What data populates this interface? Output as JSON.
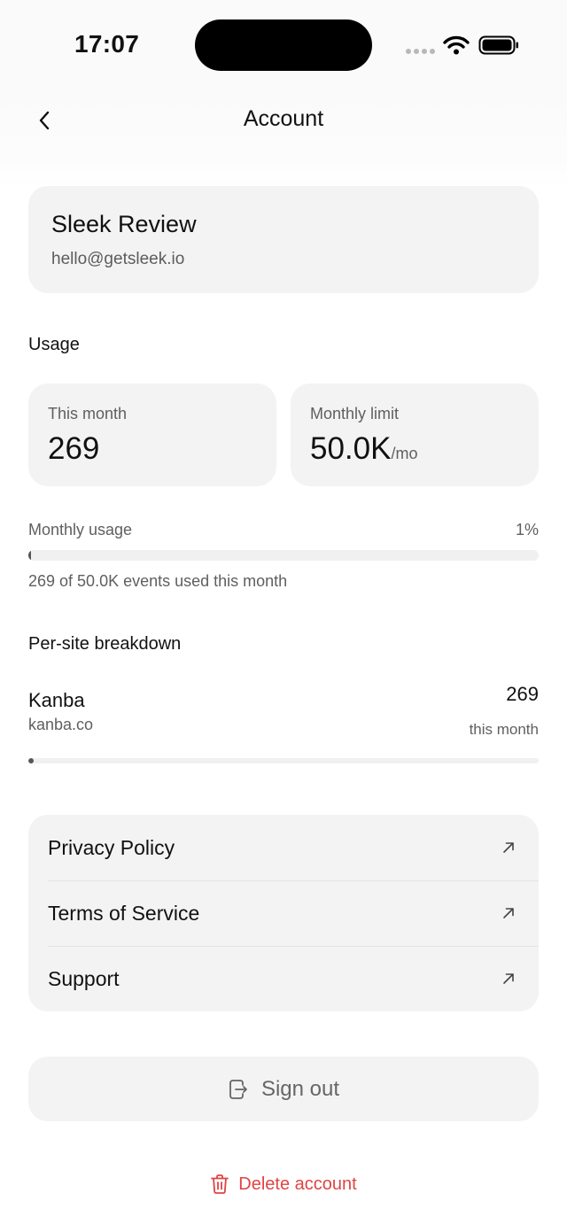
{
  "status": {
    "time": "17:07"
  },
  "nav": {
    "title": "Account"
  },
  "profile": {
    "name": "Sleek Review",
    "email": "hello@getsleek.io"
  },
  "usage": {
    "section_label": "Usage",
    "this_month_label": "This month",
    "this_month_value": "269",
    "limit_label": "Monthly limit",
    "limit_value": "50.0K",
    "limit_unit": "/mo",
    "progress_label": "Monthly usage",
    "progress_percent": "1%",
    "progress_fraction": 0.0054,
    "note": "269 of 50.0K events used this month"
  },
  "breakdown": {
    "section_label": "Per-site breakdown",
    "sites": [
      {
        "name": "Kanba",
        "domain": "kanba.co",
        "count": "269",
        "period": "this month",
        "fraction": 0.01
      }
    ]
  },
  "links": [
    {
      "label": "Privacy Policy",
      "icon": "arrow-up-right-icon"
    },
    {
      "label": "Terms of Service",
      "icon": "arrow-up-right-icon"
    },
    {
      "label": "Support",
      "icon": "arrow-up-right-icon"
    }
  ],
  "actions": {
    "sign_out": "Sign out",
    "delete_account": "Delete account"
  },
  "colors": {
    "danger": "#e04444",
    "card": "#f3f3f3",
    "muted_text": "#5f5f5f"
  }
}
